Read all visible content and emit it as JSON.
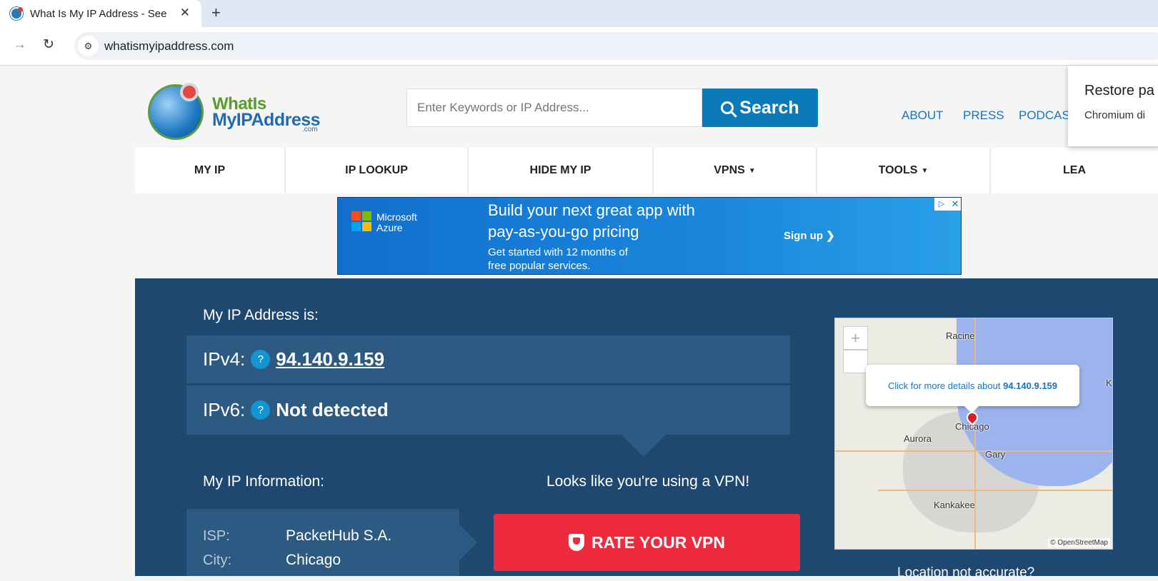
{
  "browser": {
    "tab_title": "What Is My IP Address - See",
    "tab_close": "✕",
    "new_tab": "+",
    "url": "whatismyipaddress.com"
  },
  "header": {
    "logo_line1": "WhatIs",
    "logo_line2": "MyIPAddress",
    "logo_line3": ".com",
    "search_placeholder": "Enter Keywords or IP Address...",
    "search_button": "Search",
    "top_links": [
      "ABOUT",
      "PRESS",
      "PODCAST"
    ]
  },
  "nav": {
    "items": [
      {
        "label": "MY IP",
        "caret": ""
      },
      {
        "label": "IP LOOKUP",
        "caret": ""
      },
      {
        "label": "HIDE MY IP",
        "caret": ""
      },
      {
        "label": "VPNS",
        "caret": "▼"
      },
      {
        "label": "TOOLS",
        "caret": "▼"
      },
      {
        "label": "LEA",
        "caret": ""
      }
    ]
  },
  "ad": {
    "brand_line1": "Microsoft",
    "brand_line2": "Azure",
    "headline_line1": "Build your next great app with",
    "headline_line2": "pay-as-you-go pricing",
    "sub_line1": "Get started with 12 months of",
    "sub_line2": "free popular services.",
    "cta": "Sign up ❯",
    "choices": "▷",
    "close": "✕",
    "logo_colors": [
      "#f25022",
      "#7fba00",
      "#00a4ef",
      "#ffb900"
    ]
  },
  "ip": {
    "heading": "My IP Address is:",
    "ipv4_label": "IPv4:",
    "ipv4_value": "94.140.9.159",
    "ipv6_label": "IPv6:",
    "ipv6_value": "Not detected",
    "help": "?"
  },
  "info": {
    "heading": "My IP Information:",
    "vpn_message": "Looks like you're using a VPN!",
    "rows": [
      {
        "key": "ISP:",
        "value": "PacketHub S.A."
      },
      {
        "key": "City:",
        "value": "Chicago"
      }
    ],
    "rate_button": "RATE YOUR VPN"
  },
  "map": {
    "zoom_in": "+",
    "zoom_out": "−",
    "popup_text": "Click for more details about ",
    "popup_ip": "94.140.9.159",
    "labels": [
      "Racine",
      "Chicago",
      "Aurora",
      "Gary",
      "Kankakee",
      "K"
    ],
    "attribution": "© OpenStreetMap",
    "location_note": "Location not accurate?"
  },
  "restore_popup": {
    "title": "Restore pa",
    "subtitle": "Chromium di"
  },
  "colors": {
    "main_bg": "#1f4871",
    "row_bg": "#2d5a82",
    "accent_blue": "#0a7bb8",
    "rate_red": "#ee2a3f"
  }
}
